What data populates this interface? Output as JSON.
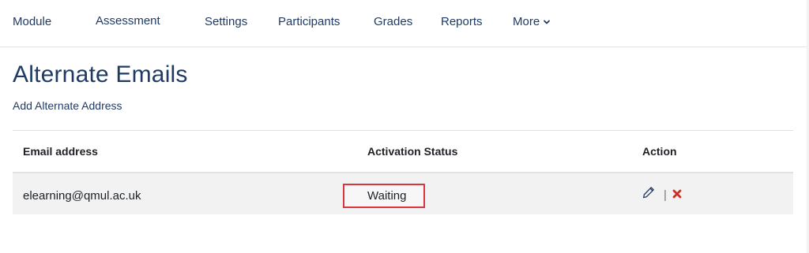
{
  "nav": {
    "items": [
      {
        "label": "Module"
      },
      {
        "label": "Assessment"
      },
      {
        "label": "Settings"
      },
      {
        "label": "Participants"
      },
      {
        "label": "Grades"
      },
      {
        "label": "Reports"
      },
      {
        "label": "More"
      }
    ]
  },
  "page": {
    "title": "Alternate Emails",
    "add_link": "Add Alternate Address"
  },
  "table": {
    "headers": [
      "Email address",
      "Activation Status",
      "Action"
    ],
    "rows": [
      {
        "email": "elearning@qmul.ac.uk",
        "status": "Waiting",
        "separator": "|"
      }
    ]
  },
  "icons": {
    "edit": "pencil-icon",
    "delete": "close-icon",
    "more": "chevron-down-icon"
  },
  "colors": {
    "link": "#1f3b63",
    "highlight": "#d9363e",
    "delete": "#ca3120",
    "row_bg": "#f2f2f2"
  }
}
